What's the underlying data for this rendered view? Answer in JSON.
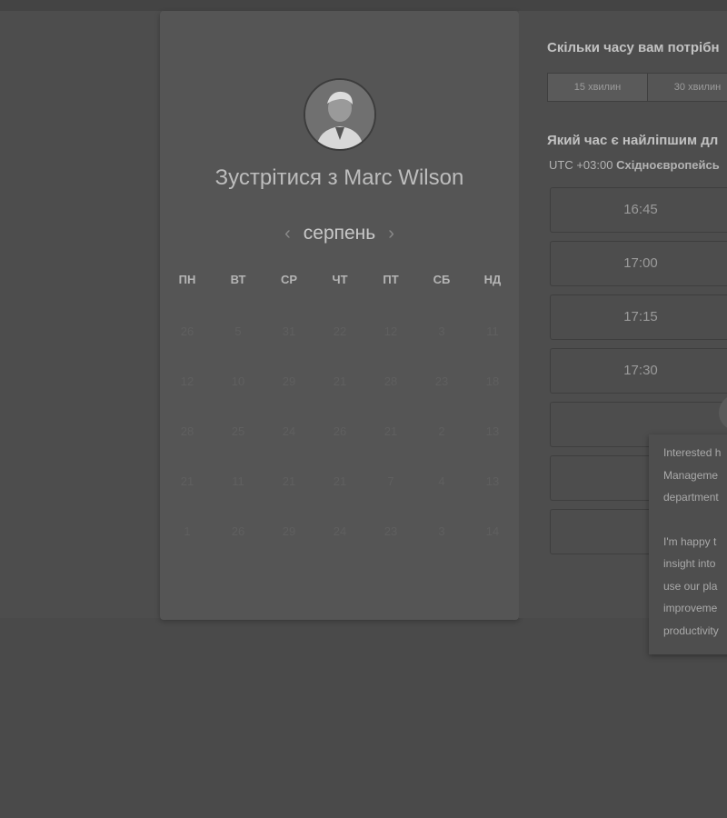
{
  "meeting": {
    "title": "Зустрітися з Marc Wilson",
    "month": "серпень"
  },
  "calendar": {
    "weekdays": [
      "ПН",
      "ВТ",
      "СР",
      "ЧТ",
      "ПТ",
      "СБ",
      "НД"
    ],
    "days": [
      "26",
      "5",
      "31",
      "22",
      "12",
      "3",
      "11",
      "12",
      "10",
      "29",
      "21",
      "28",
      "23",
      "18",
      "28",
      "25",
      "24",
      "26",
      "21",
      "2",
      "13",
      "21",
      "11",
      "21",
      "21",
      "7",
      "4",
      "13",
      "1",
      "26",
      "29",
      "24",
      "23",
      "3",
      "14"
    ]
  },
  "duration": {
    "question": "Скільки часу вам потрібн",
    "options": [
      "15 хвилин",
      "30 хвилин"
    ]
  },
  "time": {
    "question": "Який час є найліпшим дл",
    "tz_offset": "UTC +03:00",
    "tz_name": "Східноєвропейсь",
    "slots": [
      "16:45",
      "17:00",
      "17:15",
      "17:30",
      "",
      "",
      ""
    ]
  },
  "popup": {
    "para1": [
      "Interested h",
      "Manageme",
      "department"
    ],
    "para2": [
      "I'm happy t",
      "insight into",
      "use our pla",
      "improveme",
      "productivity"
    ]
  }
}
